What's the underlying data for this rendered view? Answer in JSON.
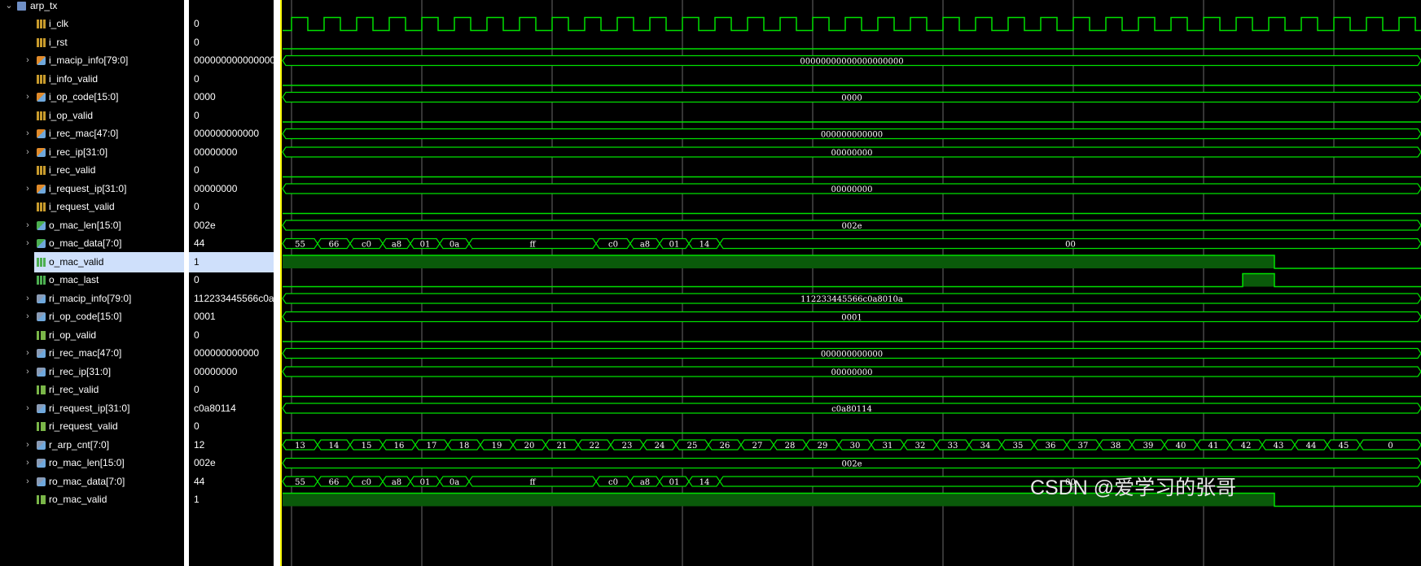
{
  "module": {
    "name": "arp_tx",
    "icon": "module-icon"
  },
  "signals": [
    {
      "name": "i_clk",
      "value": "0",
      "kind": "b1",
      "icon": "input-bit-icon",
      "expandable": false
    },
    {
      "name": "i_rst",
      "value": "0",
      "kind": "b1",
      "icon": "input-bit-icon",
      "expandable": false
    },
    {
      "name": "i_macip_info[79:0]",
      "value": "00000000000000000000",
      "kind": "bus",
      "icon": "input-bus-icon",
      "expandable": true,
      "bus_label": "00000000000000000000"
    },
    {
      "name": "i_info_valid",
      "value": "0",
      "kind": "b1",
      "icon": "input-bit-icon",
      "expandable": false
    },
    {
      "name": "i_op_code[15:0]",
      "value": "0000",
      "kind": "bus",
      "icon": "input-bus-icon",
      "expandable": true,
      "bus_label": "0000"
    },
    {
      "name": "i_op_valid",
      "value": "0",
      "kind": "b1",
      "icon": "input-bit-icon",
      "expandable": false
    },
    {
      "name": "i_rec_mac[47:0]",
      "value": "000000000000",
      "kind": "bus",
      "icon": "input-bus-icon",
      "expandable": true,
      "bus_label": "000000000000"
    },
    {
      "name": "i_rec_ip[31:0]",
      "value": "00000000",
      "kind": "bus",
      "icon": "input-bus-icon",
      "expandable": true,
      "bus_label": "00000000"
    },
    {
      "name": "i_rec_valid",
      "value": "0",
      "kind": "b1",
      "icon": "input-bit-icon",
      "expandable": false
    },
    {
      "name": "i_request_ip[31:0]",
      "value": "00000000",
      "kind": "bus",
      "icon": "input-bus-icon",
      "expandable": true,
      "bus_label": "00000000"
    },
    {
      "name": "i_request_valid",
      "value": "0",
      "kind": "b1",
      "icon": "input-bit-icon",
      "expandable": false
    },
    {
      "name": "o_mac_len[15:0]",
      "value": "002e",
      "kind": "outbus",
      "icon": "output-bus-icon",
      "expandable": true,
      "bus_label": "002e"
    },
    {
      "name": "o_mac_data[7:0]",
      "value": "44",
      "kind": "outbus",
      "icon": "output-bus-icon",
      "expandable": true,
      "wave": "macdata"
    },
    {
      "name": "o_mac_valid",
      "value": "1",
      "kind": "outb1",
      "icon": "output-bit-icon",
      "expandable": false,
      "selected": true,
      "wave": "valid"
    },
    {
      "name": "o_mac_last",
      "value": "0",
      "kind": "outb1",
      "icon": "output-bit-icon",
      "expandable": false,
      "wave": "last"
    },
    {
      "name": "ri_macip_info[79:0]",
      "value": "112233445566c0a8010a",
      "kind": "regbus",
      "icon": "register-bus-icon",
      "expandable": true,
      "bus_label": "112233445566c0a8010a"
    },
    {
      "name": "ri_op_code[15:0]",
      "value": "0001",
      "kind": "regbus",
      "icon": "register-bus-icon",
      "expandable": true,
      "bus_label": "0001"
    },
    {
      "name": "ri_op_valid",
      "value": "0",
      "kind": "regb1",
      "icon": "register-bit-icon",
      "expandable": false
    },
    {
      "name": "ri_rec_mac[47:0]",
      "value": "000000000000",
      "kind": "regbus",
      "icon": "register-bus-icon",
      "expandable": true,
      "bus_label": "000000000000"
    },
    {
      "name": "ri_rec_ip[31:0]",
      "value": "00000000",
      "kind": "regbus",
      "icon": "register-bus-icon",
      "expandable": true,
      "bus_label": "00000000"
    },
    {
      "name": "ri_rec_valid",
      "value": "0",
      "kind": "regb1",
      "icon": "register-bit-icon",
      "expandable": false
    },
    {
      "name": "ri_request_ip[31:0]",
      "value": "c0a80114",
      "kind": "regbus",
      "icon": "register-bus-icon",
      "expandable": true,
      "bus_label": "c0a80114"
    },
    {
      "name": "ri_request_valid",
      "value": "0",
      "kind": "regb1",
      "icon": "register-bit-icon",
      "expandable": false
    },
    {
      "name": "r_arp_cnt[7:0]",
      "value": "12",
      "kind": "regbus",
      "icon": "register-bus-icon",
      "expandable": true,
      "wave": "cnt"
    },
    {
      "name": "ro_mac_len[15:0]",
      "value": "002e",
      "kind": "regbus",
      "icon": "register-bus-icon",
      "expandable": true,
      "bus_label": "002e"
    },
    {
      "name": "ro_mac_data[7:0]",
      "value": "44",
      "kind": "regbus",
      "icon": "register-bus-icon",
      "expandable": true,
      "wave": "macdata"
    },
    {
      "name": "ro_mac_valid",
      "value": "1",
      "kind": "regb1",
      "icon": "register-bit-icon",
      "expandable": false,
      "wave": "valid"
    }
  ],
  "mac_data_segments": [
    "55",
    "66",
    "c0",
    "a8",
    "01",
    "0a",
    "ff",
    "c0",
    "a8",
    "01",
    "14",
    "00"
  ],
  "arp_cnt_segments": [
    "13",
    "14",
    "15",
    "16",
    "17",
    "18",
    "19",
    "20",
    "21",
    "22",
    "23",
    "24",
    "25",
    "26",
    "27",
    "28",
    "29",
    "30",
    "31",
    "32",
    "33",
    "34",
    "35",
    "36",
    "37",
    "38",
    "39",
    "40",
    "41",
    "42",
    "43",
    "44",
    "45",
    "0"
  ],
  "watermark": "CSDN @爱学习的张哥",
  "colors": {
    "wave": "#00e000",
    "valid_fill": "#0a5a0a",
    "grid": "#6a6a6a",
    "cursor": "#ffff00",
    "selected_row": "#cfe0fb"
  }
}
